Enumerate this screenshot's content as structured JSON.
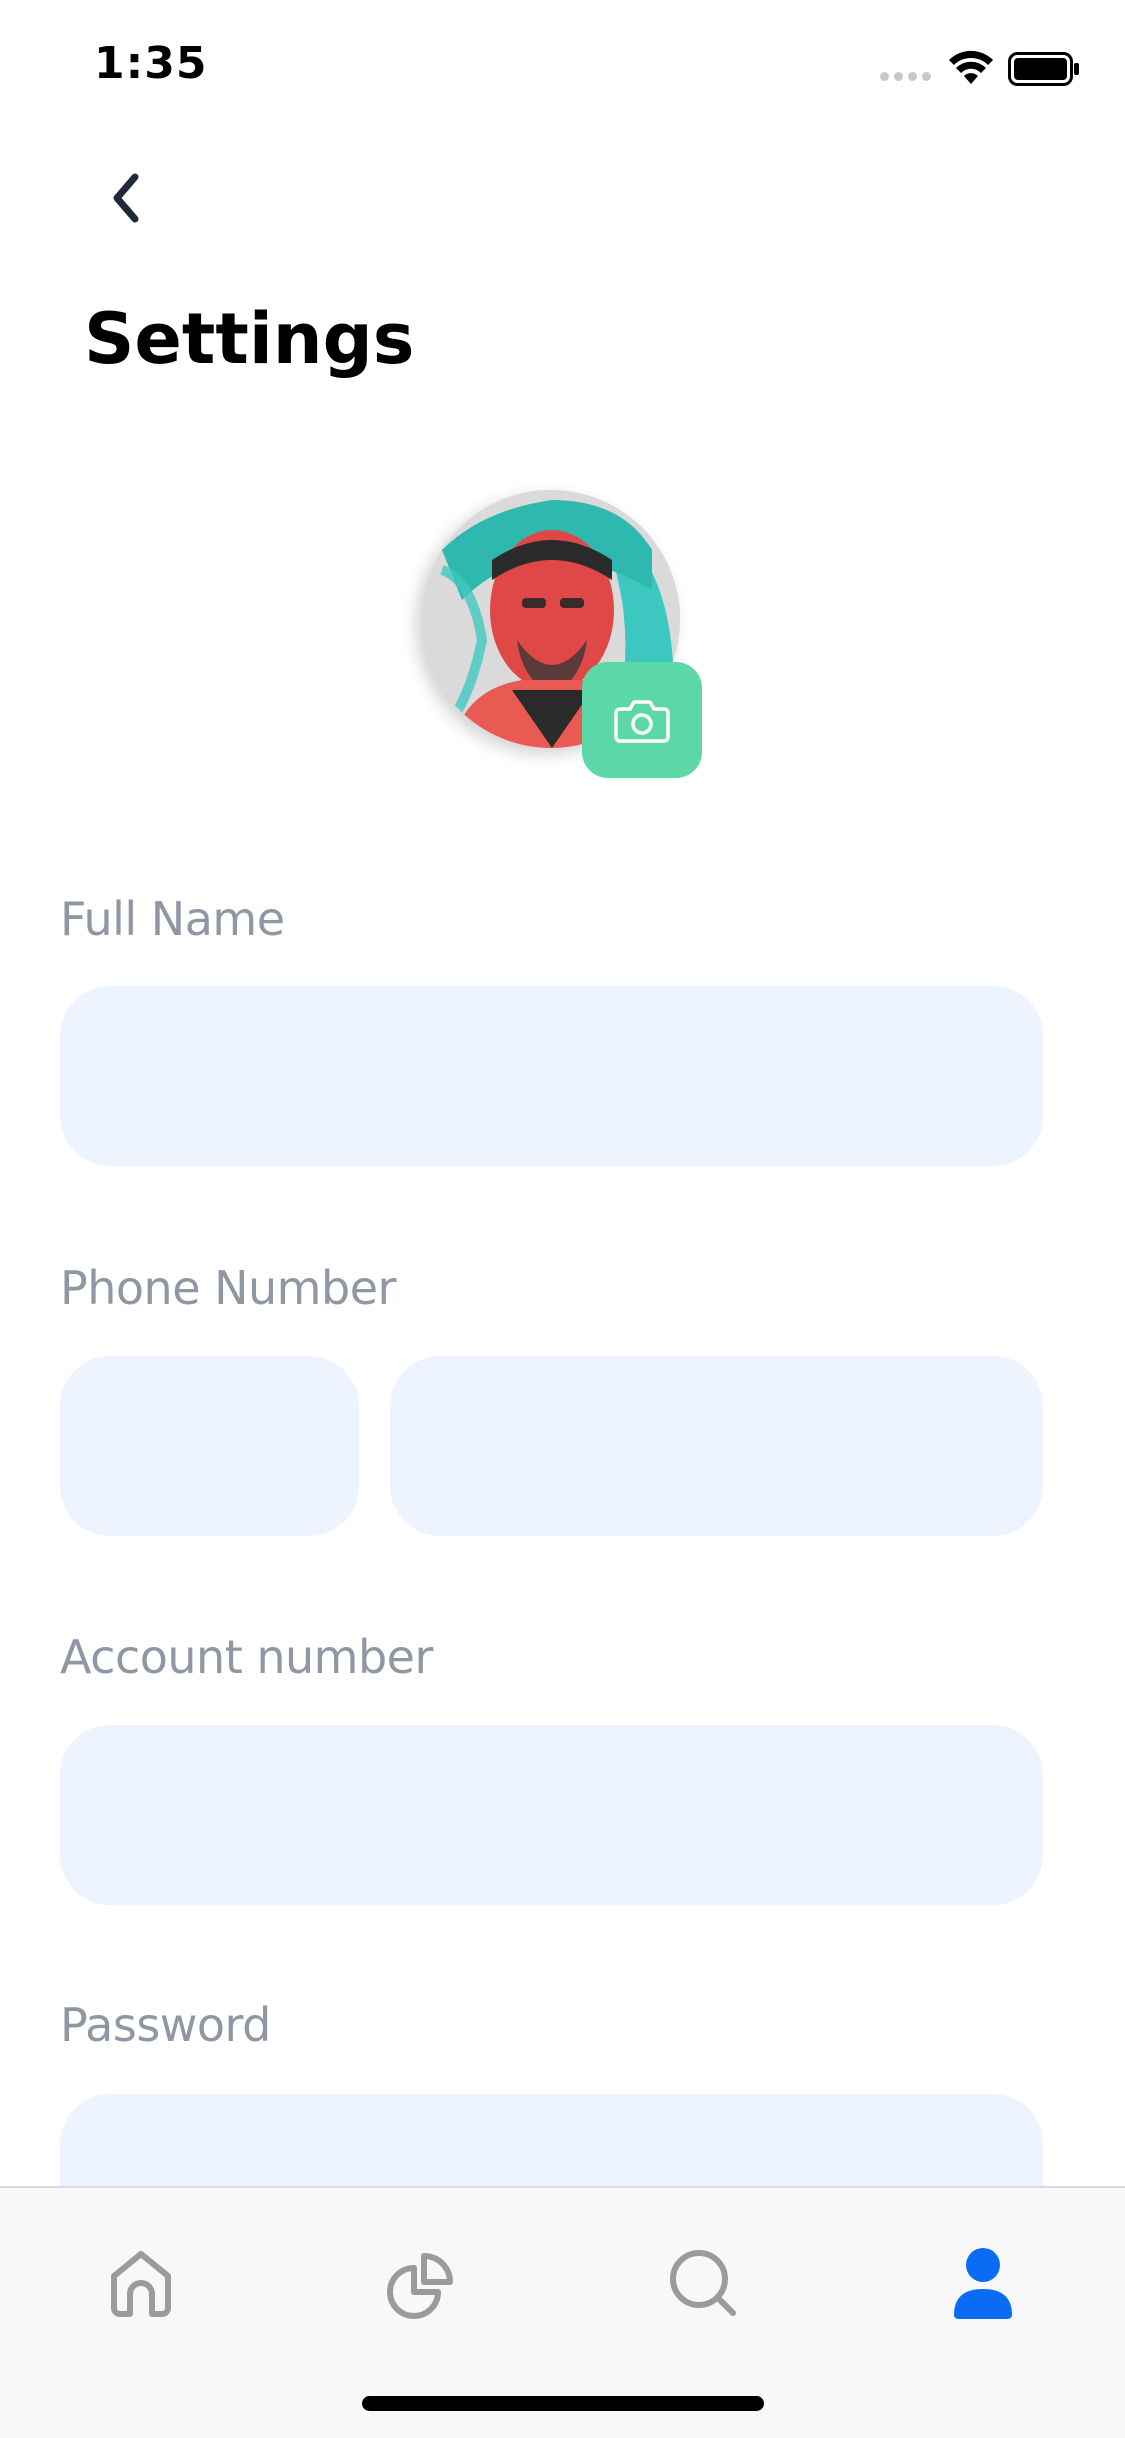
{
  "status_bar": {
    "time": "1:35"
  },
  "header": {
    "title": "Settings"
  },
  "profile": {
    "avatar_icon": "avatar-photo",
    "camera_icon": "camera-icon"
  },
  "form": {
    "full_name": {
      "label": "Full Name",
      "value": "",
      "placeholder": ""
    },
    "phone_number": {
      "label": "Phone Number",
      "code_value": "",
      "number_value": ""
    },
    "account_number": {
      "label": "Account number",
      "value": ""
    },
    "password": {
      "label": "Password",
      "value": ""
    }
  },
  "tab_bar": {
    "items": [
      {
        "icon": "home-icon",
        "active": false
      },
      {
        "icon": "pie-chart-icon",
        "active": false
      },
      {
        "icon": "search-icon",
        "active": false
      },
      {
        "icon": "profile-icon",
        "active": true
      }
    ]
  },
  "colors": {
    "accent": "#0a6cf5",
    "camera_button": "#5cd8a8",
    "input_bg": "#edf4ff",
    "label": "#8f97a4",
    "inactive_icon": "#9b9b9b"
  }
}
